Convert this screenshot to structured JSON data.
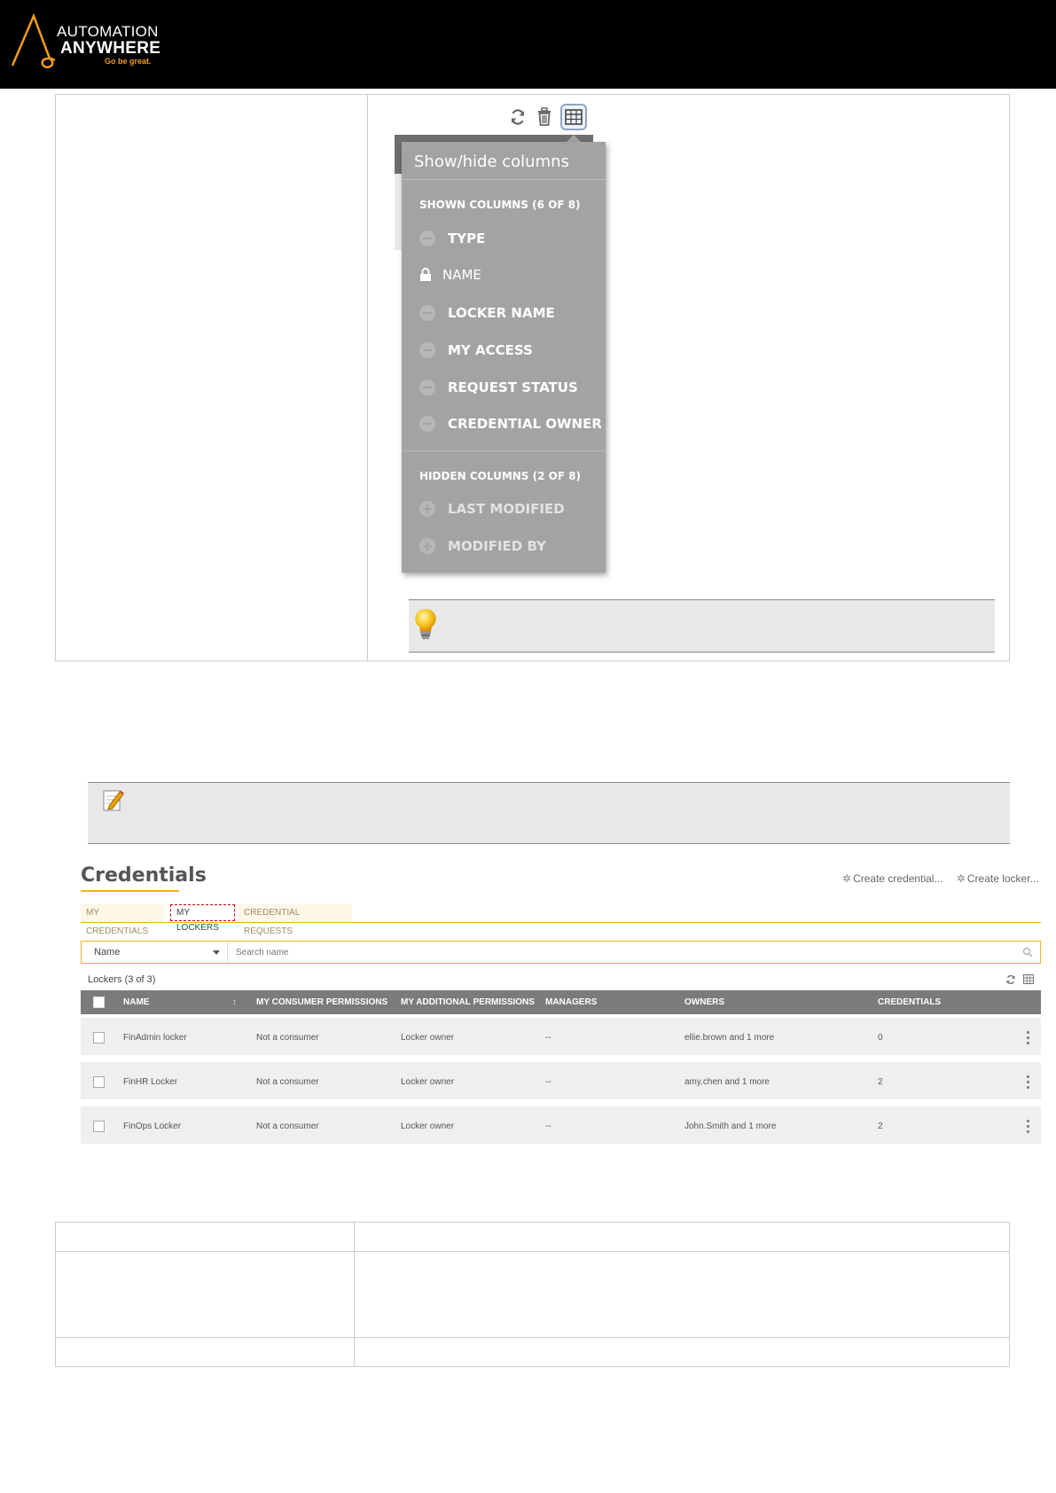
{
  "logo": {
    "line1": "AUTOMATION",
    "line2": "ANYWHERE",
    "tagline": "Go be great."
  },
  "colors": {
    "banner": "#000000",
    "accent": "#f5b21f",
    "popup_bg": "#a3a3a3",
    "grid_header": "#7b7b7b",
    "active_tab_border": "#d40000"
  },
  "toolbar": {
    "icons": [
      "refresh-icon",
      "trash-icon",
      "column-chooser-icon"
    ]
  },
  "column_popup": {
    "title": "Show/hide columns",
    "shown_heading": "SHOWN COLUMNS (6 OF 8)",
    "shown_columns": [
      "TYPE",
      "NAME",
      "LOCKER NAME",
      "MY ACCESS",
      "REQUEST STATUS",
      "CREDENTIAL OWNER"
    ],
    "hidden_heading": "HIDDEN COLUMNS (2 OF 8)",
    "hidden_columns": [
      "LAST MODIFIED",
      "MODIFIED BY"
    ]
  },
  "credentials": {
    "title": "Credentials",
    "create_credential": "Create credential...",
    "create_locker": "Create locker...",
    "tabs": [
      "MY CREDENTIALS",
      "MY LOCKERS",
      "CREDENTIAL REQUESTS"
    ],
    "active_tab": "MY LOCKERS",
    "search": {
      "field": "Name",
      "placeholder": "Search name"
    },
    "count_label": "Lockers (3 of 3)",
    "columns": [
      "NAME",
      "MY CONSUMER PERMISSIONS",
      "MY ADDITIONAL PERMISSIONS",
      "MANAGERS",
      "OWNERS",
      "CREDENTIALS"
    ],
    "rows": [
      {
        "name": "FinAdmin locker",
        "consumer": "Not a consumer",
        "additional": "Locker owner",
        "managers": "--",
        "owners": "ellie.brown and 1 more",
        "credentials": "0"
      },
      {
        "name": "FinHR Locker",
        "consumer": "Not a consumer",
        "additional": "Locker owner",
        "managers": "--",
        "owners": "amy.chen and 1 more",
        "credentials": "2"
      },
      {
        "name": "FinOps Locker",
        "consumer": "Not a consumer",
        "additional": "Locker owner",
        "managers": "--",
        "owners": "John.Smith and 1 more",
        "credentials": "2"
      }
    ]
  }
}
